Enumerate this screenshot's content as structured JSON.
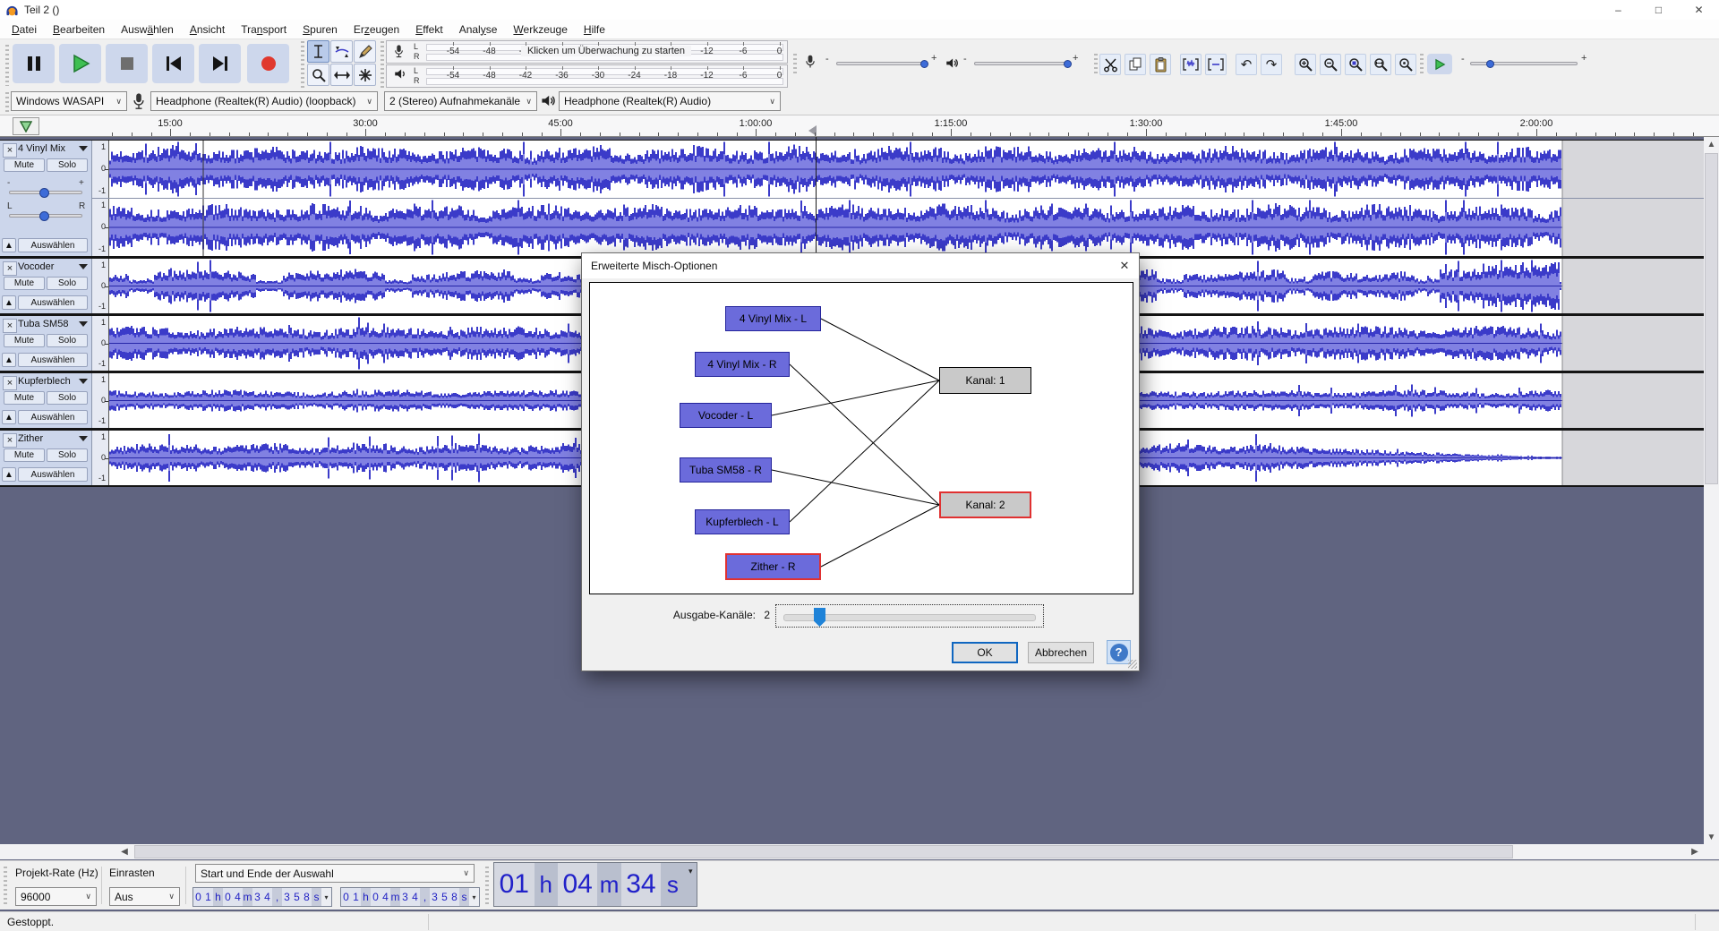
{
  "window": {
    "title": "Teil 2 ()"
  },
  "menu": {
    "items": [
      {
        "label": "Datei",
        "underline": 0
      },
      {
        "label": "Bearbeiten",
        "underline": 0
      },
      {
        "label": "Auswählen",
        "underline": 4
      },
      {
        "label": "Ansicht",
        "underline": 0
      },
      {
        "label": "Transport",
        "underline": 3
      },
      {
        "label": "Spuren",
        "underline": 0
      },
      {
        "label": "Erzeugen",
        "underline": 2
      },
      {
        "label": "Effekt",
        "underline": 0
      },
      {
        "label": "Analyse",
        "underline": 4
      },
      {
        "label": "Werkzeuge",
        "underline": 0
      },
      {
        "label": "Hilfe",
        "underline": 0
      }
    ]
  },
  "transport": {
    "buttons": [
      "pause",
      "play",
      "stop",
      "skip-to-start",
      "skip-to-end",
      "record"
    ]
  },
  "tools": [
    "selection-tool",
    "envelope-tool",
    "draw-tool",
    "zoom-tool",
    "time-shift-tool",
    "multi-tool"
  ],
  "meters": {
    "ticks": [
      "-54",
      "-48",
      "-42",
      "-36",
      "-30",
      "-24",
      "-18",
      "-12",
      "-6",
      "0"
    ],
    "recording": {
      "channels": [
        "L",
        "R"
      ],
      "overlay": "Klicken um Überwachung zu starten"
    },
    "playback": {
      "channels": [
        "L",
        "R"
      ]
    }
  },
  "mixer": {
    "minus": "-",
    "plus": "+"
  },
  "device": {
    "host": "Windows WASAPI",
    "recording_device": "Headphone (Realtek(R) Audio) (loopback)",
    "recording_channels": "2 (Stereo) Aufnahmekanäle",
    "playback_device": "Headphone (Realtek(R) Audio)"
  },
  "timeline": {
    "labels": [
      "15:00",
      "30:00",
      "45:00",
      "1:00:00",
      "1:15:00",
      "1:30:00",
      "1:45:00",
      "2:00:00"
    ]
  },
  "tracks": {
    "mute_label": "Mute",
    "solo_label": "Solo",
    "select_label": "Auswählen",
    "ruler_labels": [
      "1",
      "0",
      "-1"
    ],
    "pan_left": "L",
    "pan_right": "R",
    "items": [
      {
        "name": "4 Vinyl Mix",
        "stereo": true
      },
      {
        "name": "Vocoder",
        "stereo": false
      },
      {
        "name": "Tuba SM58",
        "stereo": false
      },
      {
        "name": "Kupferblech",
        "stereo": false
      },
      {
        "name": "Zither",
        "stereo": false
      }
    ]
  },
  "dialog": {
    "title": "Erweiterte Misch-Optionen",
    "sources": [
      {
        "label": "4 Vinyl Mix - L",
        "selected": false
      },
      {
        "label": "4 Vinyl Mix - R",
        "selected": false
      },
      {
        "label": "Vocoder - L",
        "selected": false
      },
      {
        "label": "Tuba SM58 - R",
        "selected": false
      },
      {
        "label": "Kupferblech - L",
        "selected": false
      },
      {
        "label": "Zither - R",
        "selected": true
      }
    ],
    "channels": [
      {
        "label": "Kanal:  1",
        "selected": false
      },
      {
        "label": "Kanal:  2",
        "selected": true
      }
    ],
    "connections": [
      [
        0,
        0
      ],
      [
        1,
        1
      ],
      [
        2,
        0
      ],
      [
        3,
        1
      ],
      [
        4,
        0
      ],
      [
        5,
        1
      ]
    ],
    "output_channels_label": "Ausgabe-Kanäle:",
    "output_channels_value": "2",
    "ok_label": "OK",
    "cancel_label": "Abbrechen",
    "help_label": "?"
  },
  "selection_toolbar": {
    "project_rate_label": "Projekt-Rate (Hz)",
    "project_rate_value": "96000",
    "snap_label": "Einrasten",
    "snap_value": "Aus",
    "range_mode": "Start und Ende der Auswahl",
    "selection_start": "01h04m34,358s",
    "selection_end": "01h04m34,358s"
  },
  "time_display": {
    "tokens": [
      "01",
      "h",
      "04",
      "m",
      "34",
      "s"
    ]
  },
  "status": {
    "text": "Gestoppt."
  },
  "colors": {
    "waveform": "#3b3bc9",
    "waveform_inner": "#8181e2",
    "waveform_center": "#2626a8",
    "record_button": "#e0382e",
    "play_button": "#31a24c",
    "selected_border": "#e03131",
    "source_box": "#6b6bdb",
    "channel_box": "#c9c9c9"
  }
}
